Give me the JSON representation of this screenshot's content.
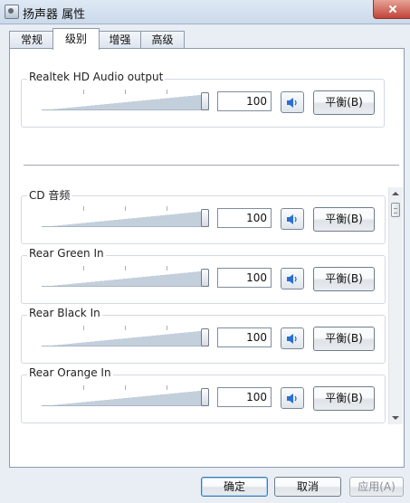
{
  "window": {
    "title": "扬声器 属性"
  },
  "tabs": [
    {
      "label": "常规"
    },
    {
      "label": "级别"
    },
    {
      "label": "增强"
    },
    {
      "label": "高级"
    }
  ],
  "active_tab": "级别",
  "master": {
    "name": "Realtek HD Audio output",
    "value": "100",
    "level_percent": 100,
    "balance_label": "平衡(B)",
    "muted": false
  },
  "channels": [
    {
      "name": "CD 音频",
      "value": "100",
      "level_percent": 100,
      "balance_label": "平衡(B)",
      "muted": false
    },
    {
      "name": "Rear Green In",
      "value": "100",
      "level_percent": 100,
      "balance_label": "平衡(B)",
      "muted": false
    },
    {
      "name": "Rear Black In",
      "value": "100",
      "level_percent": 100,
      "balance_label": "平衡(B)",
      "muted": false
    },
    {
      "name": "Rear Orange In",
      "value": "100",
      "level_percent": 100,
      "balance_label": "平衡(B)",
      "muted": false
    }
  ],
  "footer": {
    "ok_label": "确定",
    "cancel_label": "取消",
    "apply_label": "应用(A)",
    "apply_enabled": false
  },
  "icons": {
    "window": "speaker-properties-icon",
    "speaker": "speaker-icon",
    "close": "close-icon"
  },
  "colors": {
    "speaker_blue": "#2a6fd1",
    "close_red": "#c2443a"
  }
}
